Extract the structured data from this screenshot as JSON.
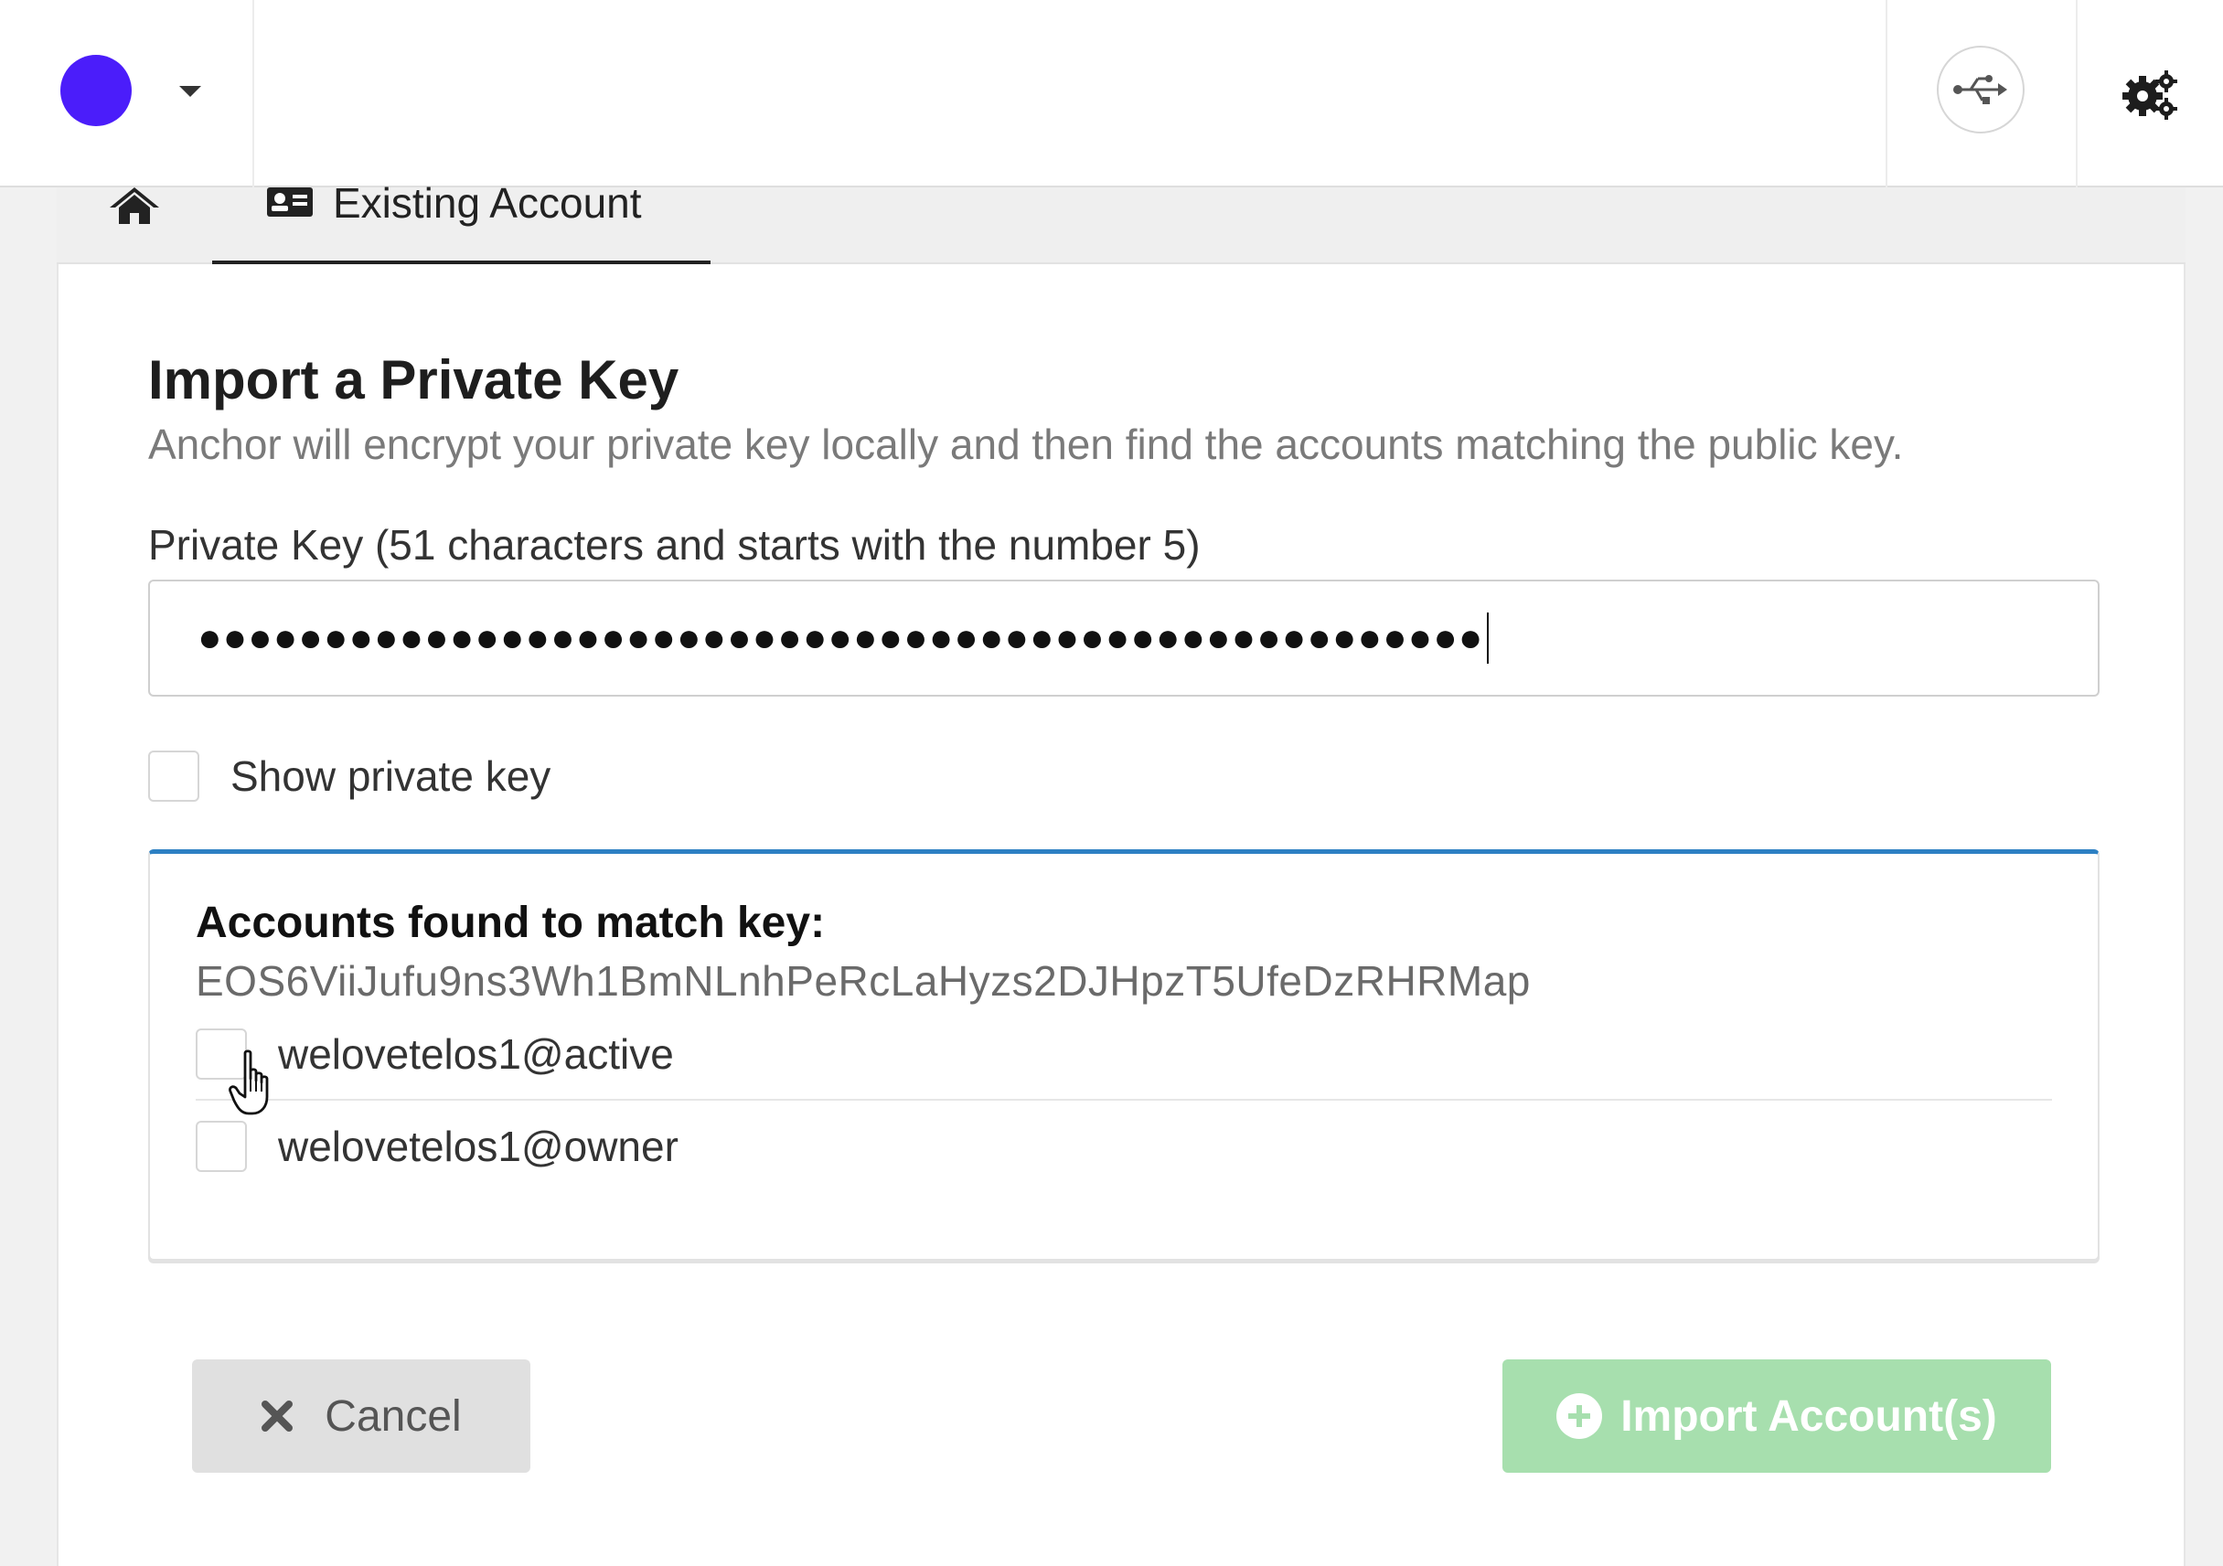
{
  "header": {
    "chain_color": "#4b1dfa",
    "chain_icon": "chain-circle-icon",
    "usb_icon": "usb-icon",
    "settings_icon": "gears-icon"
  },
  "tabs": [
    {
      "icon": "home-icon",
      "label": ""
    },
    {
      "icon": "id-card-icon",
      "label": "Existing Account",
      "active": true
    }
  ],
  "form": {
    "title": "Import a Private Key",
    "description": "Anchor will encrypt your private key locally and then find the accounts matching the public key.",
    "key_label": "Private Key (51 characters and starts with the number 5)",
    "key_masked": "●●●●●●●●●●●●●●●●●●●●●●●●●●●●●●●●●●●●●●●●●●●●●●●●●●●",
    "show_key_label": "Show private key"
  },
  "accounts": {
    "heading": "Accounts found to match key:",
    "public_key": "EOS6ViiJufu9ns3Wh1BmNLnhPeRcLaHyzs2DJHpzT5UfeDzRHRMap",
    "items": [
      {
        "name": "welovetelos1@active"
      },
      {
        "name": "welovetelos1@owner"
      }
    ]
  },
  "actions": {
    "cancel_label": "Cancel",
    "import_label": "Import Account(s)",
    "import_color": "#a7dfae"
  }
}
